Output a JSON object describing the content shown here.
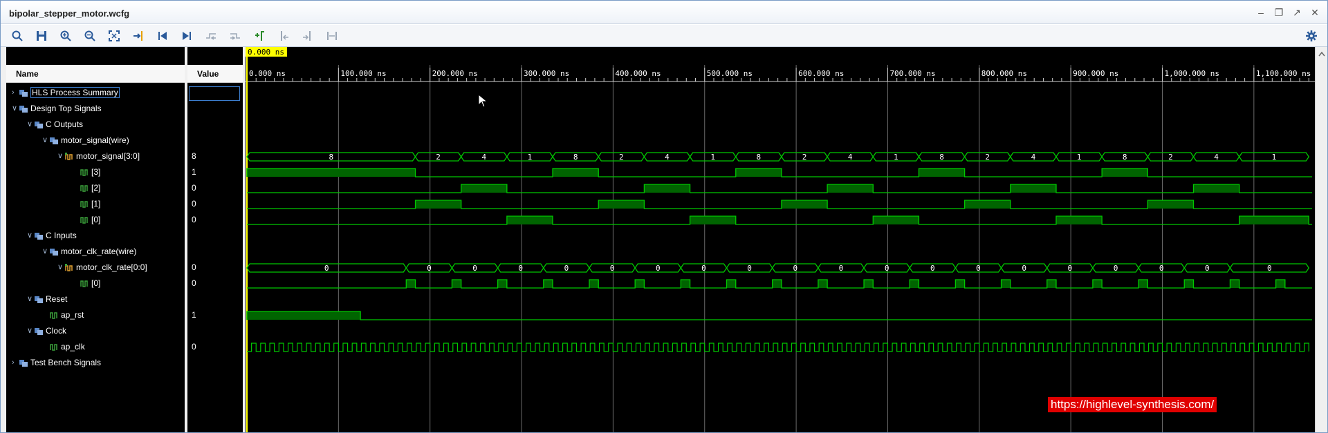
{
  "window": {
    "title": "bipolar_stepper_motor.wcfg"
  },
  "toolbar": {
    "tools": [
      "search-icon",
      "save-icon",
      "zoom-in-icon",
      "zoom-out-icon",
      "zoom-fit-icon",
      "go-to-cursor-icon",
      "go-to-start-icon",
      "go-to-end-icon",
      "previous-transition-icon",
      "next-transition-icon",
      "add-marker-icon",
      "previous-marker-icon",
      "next-marker-icon",
      "swap-cursors-icon"
    ],
    "settings": "gear-icon"
  },
  "columns": {
    "name": "Name",
    "value": "Value"
  },
  "tree": [
    {
      "label": "HLS Process Summary",
      "value": "",
      "expanded": false,
      "indent": 0,
      "icon": "group-icon"
    },
    {
      "label": "Design Top Signals",
      "value": "",
      "expanded": true,
      "indent": 0,
      "icon": "group-icon"
    },
    {
      "label": "C Outputs",
      "value": "",
      "expanded": true,
      "indent": 1,
      "icon": "group-icon"
    },
    {
      "label": "motor_signal(wire)",
      "value": "",
      "expanded": true,
      "indent": 2,
      "icon": "group-icon"
    },
    {
      "label": "motor_signal[3:0]",
      "value": "8",
      "expanded": true,
      "indent": 3,
      "icon": "bus-icon"
    },
    {
      "label": "[3]",
      "value": "1",
      "indent": 4,
      "icon": "signal-icon"
    },
    {
      "label": "[2]",
      "value": "0",
      "indent": 4,
      "icon": "signal-icon"
    },
    {
      "label": "[1]",
      "value": "0",
      "indent": 4,
      "icon": "signal-icon"
    },
    {
      "label": "[0]",
      "value": "0",
      "indent": 4,
      "icon": "signal-icon"
    },
    {
      "label": "C Inputs",
      "value": "",
      "expanded": true,
      "indent": 1,
      "icon": "group-icon"
    },
    {
      "label": "motor_clk_rate(wire)",
      "value": "",
      "expanded": true,
      "indent": 2,
      "icon": "group-icon"
    },
    {
      "label": "motor_clk_rate[0:0]",
      "value": "0",
      "expanded": true,
      "indent": 3,
      "icon": "bus-icon"
    },
    {
      "label": "[0]",
      "value": "0",
      "indent": 4,
      "icon": "signal-icon"
    },
    {
      "label": "Reset",
      "value": "",
      "expanded": true,
      "indent": 1,
      "icon": "group-icon"
    },
    {
      "label": "ap_rst",
      "value": "1",
      "indent": 2,
      "icon": "signal-icon"
    },
    {
      "label": "Clock",
      "value": "",
      "expanded": true,
      "indent": 1,
      "icon": "group-icon"
    },
    {
      "label": "ap_clk",
      "value": "0",
      "indent": 2,
      "icon": "signal-icon"
    },
    {
      "label": "Test Bench Signals",
      "value": "",
      "expanded": false,
      "indent": 0,
      "icon": "group-icon"
    }
  ],
  "cursor_time": "0.000 ns",
  "timeline": {
    "ticks": [
      "0.000 ns",
      "100.000 ns",
      "200.000 ns",
      "300.000 ns",
      "400.000 ns",
      "500.000 ns",
      "600.000 ns",
      "700.000 ns",
      "800.000 ns",
      "900.000 ns",
      "1,000.000 ns",
      "1,100.000 ns"
    ],
    "t_max_ns": 1160
  },
  "waveforms": {
    "motor_signal_bus": {
      "segments": [
        [
          0,
          184,
          "8"
        ],
        [
          184,
          234,
          "2"
        ],
        [
          234,
          284,
          "4"
        ],
        [
          284,
          334,
          "1"
        ],
        [
          334,
          384,
          "8"
        ],
        [
          384,
          434,
          "2"
        ],
        [
          434,
          484,
          "4"
        ],
        [
          484,
          534,
          "1"
        ],
        [
          534,
          584,
          "8"
        ],
        [
          584,
          634,
          "2"
        ],
        [
          634,
          684,
          "4"
        ],
        [
          684,
          734,
          "1"
        ],
        [
          734,
          784,
          "8"
        ],
        [
          784,
          834,
          "2"
        ],
        [
          834,
          884,
          "4"
        ],
        [
          884,
          934,
          "1"
        ],
        [
          934,
          984,
          "8"
        ],
        [
          984,
          1034,
          "2"
        ],
        [
          1034,
          1084,
          "4"
        ],
        [
          1084,
          1160,
          "1"
        ]
      ]
    },
    "bit3_high": [
      [
        0,
        184
      ],
      [
        334,
        384
      ],
      [
        534,
        584
      ],
      [
        734,
        784
      ],
      [
        934,
        984
      ]
    ],
    "bit2_high": [
      [
        234,
        284
      ],
      [
        434,
        484
      ],
      [
        634,
        684
      ],
      [
        834,
        884
      ],
      [
        1034,
        1084
      ]
    ],
    "bit1_high": [
      [
        184,
        234
      ],
      [
        384,
        434
      ],
      [
        584,
        634
      ],
      [
        784,
        834
      ],
      [
        984,
        1034
      ]
    ],
    "bit0_high": [
      [
        284,
        334
      ],
      [
        484,
        534
      ],
      [
        684,
        734
      ],
      [
        884,
        934
      ],
      [
        1084,
        1160
      ]
    ],
    "motor_clk_rate_bus": {
      "segments": [
        [
          0,
          174,
          "0"
        ],
        [
          174,
          224,
          "0"
        ],
        [
          224,
          274,
          "0"
        ],
        [
          274,
          324,
          "0"
        ],
        [
          324,
          374,
          "0"
        ],
        [
          374,
          424,
          "0"
        ],
        [
          424,
          474,
          "0"
        ],
        [
          474,
          524,
          "0"
        ],
        [
          524,
          574,
          "0"
        ],
        [
          574,
          624,
          "0"
        ],
        [
          624,
          674,
          "0"
        ],
        [
          674,
          724,
          "0"
        ],
        [
          724,
          774,
          "0"
        ],
        [
          774,
          824,
          "0"
        ],
        [
          824,
          874,
          "0"
        ],
        [
          874,
          924,
          "0"
        ],
        [
          924,
          974,
          "0"
        ],
        [
          974,
          1024,
          "0"
        ],
        [
          1024,
          1074,
          "0"
        ],
        [
          1074,
          1160,
          "0"
        ]
      ]
    },
    "clk_rate_bit_pulses": [
      174,
      224,
      274,
      324,
      374,
      424,
      474,
      524,
      574,
      624,
      674,
      724,
      774,
      824,
      874,
      924,
      974,
      1024,
      1074,
      1124
    ],
    "clk_rate_pulse_width_ns": 10,
    "ap_rst_high": [
      [
        0,
        124
      ]
    ],
    "ap_clk_period_ns": 10
  },
  "watermark": "https://highlevel-synthesis.com/",
  "colors": {
    "wave": "#00c800",
    "wave_fill": "#006400",
    "grid": "#6b6b6b",
    "cursor": "#ffff00",
    "bus_text": "#ffffff"
  }
}
